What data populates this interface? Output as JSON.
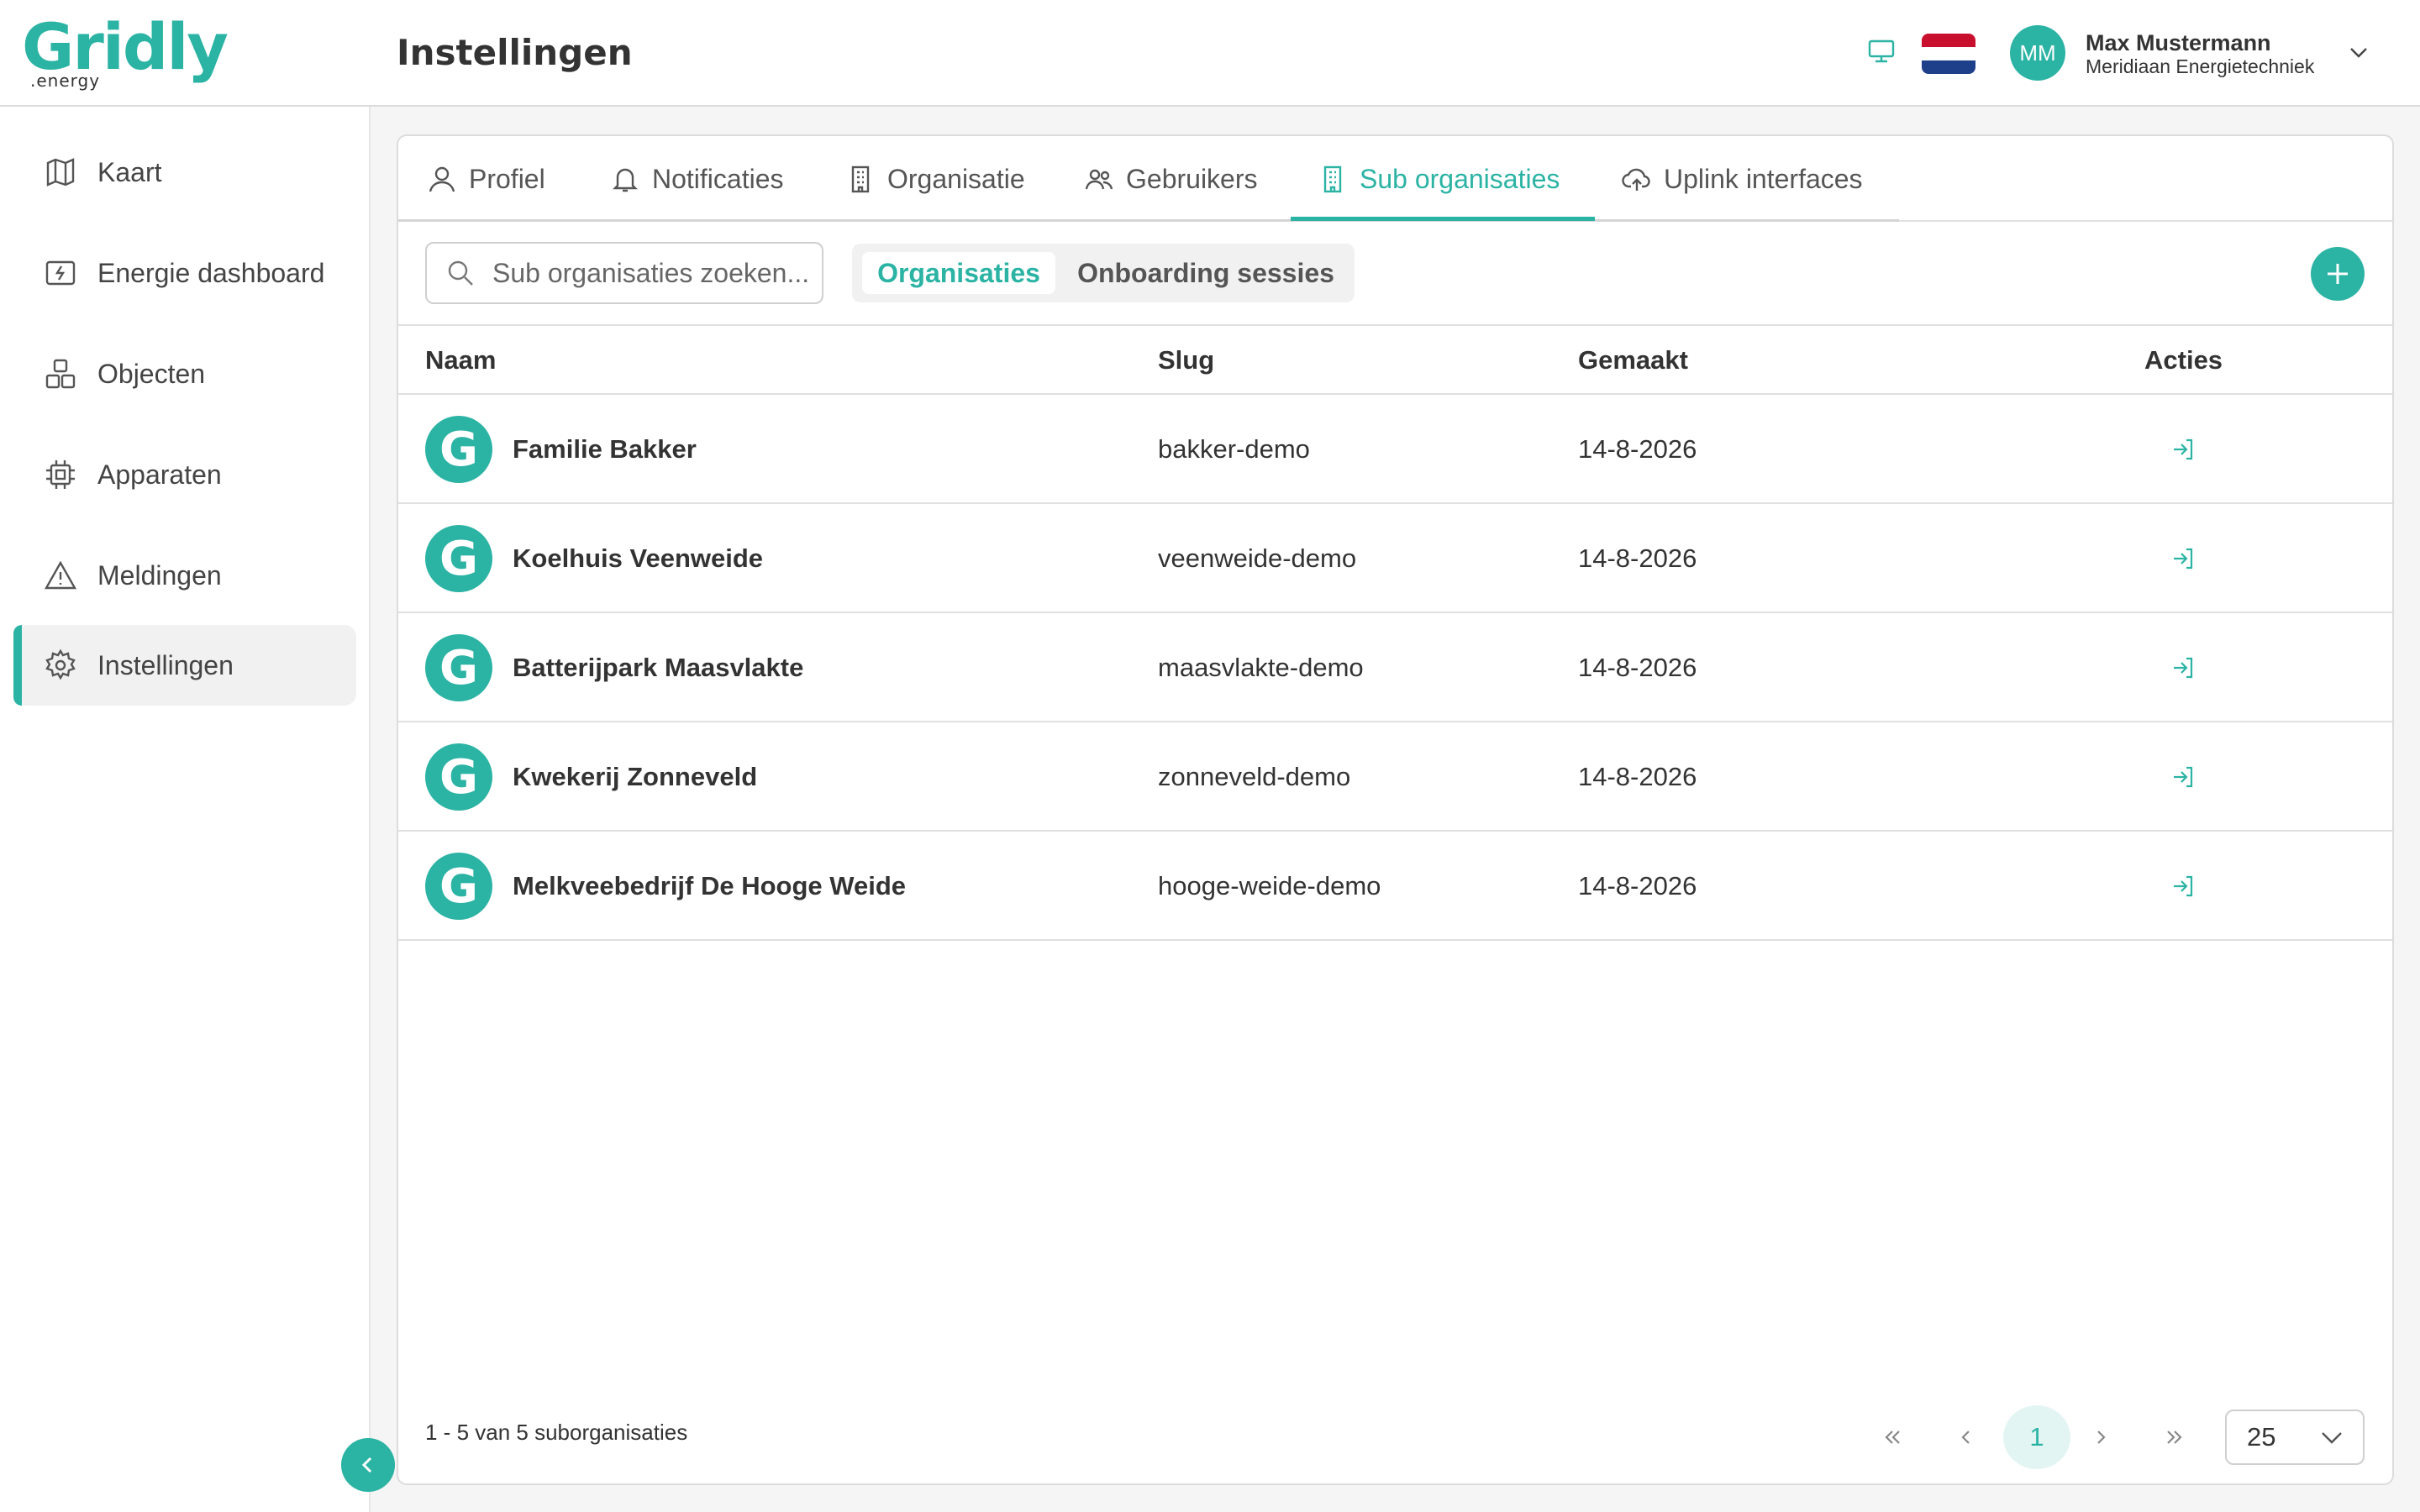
{
  "brand": {
    "name": "Gridly",
    "suffix": ".energy",
    "accent": "#2bb3a4"
  },
  "header": {
    "title": "Instellingen"
  },
  "user": {
    "initials": "MM",
    "name": "Max Mustermann",
    "organization": "Meridiaan Energietechniek"
  },
  "sidebar": {
    "items": [
      {
        "label": "Kaart",
        "icon": "map-icon"
      },
      {
        "label": "Energie dashboard",
        "icon": "dashboard-icon"
      },
      {
        "label": "Objecten",
        "icon": "objects-icon"
      },
      {
        "label": "Apparaten",
        "icon": "chip-icon"
      },
      {
        "label": "Meldingen",
        "icon": "warning-icon"
      },
      {
        "label": "Instellingen",
        "icon": "gear-icon",
        "active": true
      }
    ]
  },
  "tabs": [
    {
      "label": "Profiel",
      "icon": "user-icon"
    },
    {
      "label": "Notificaties",
      "icon": "bell-icon"
    },
    {
      "label": "Organisatie",
      "icon": "building-icon"
    },
    {
      "label": "Gebruikers",
      "icon": "users-icon"
    },
    {
      "label": "Sub organisaties",
      "icon": "building-icon",
      "active": true
    },
    {
      "label": "Uplink interfaces",
      "icon": "cloud-upload-icon"
    }
  ],
  "search": {
    "placeholder": "Sub organisaties zoeken..."
  },
  "segment": {
    "options": [
      "Organisaties",
      "Onboarding sessies"
    ],
    "selected": "Organisaties"
  },
  "table": {
    "columns": [
      "Naam",
      "Slug",
      "Gemaakt",
      "Acties"
    ],
    "rows": [
      {
        "logo": "G",
        "name": "Familie Bakker",
        "slug": "bakker-demo",
        "created": "14-8-2026"
      },
      {
        "logo": "G",
        "name": "Koelhuis Veenweide",
        "slug": "veenweide-demo",
        "created": "14-8-2026"
      },
      {
        "logo": "G",
        "name": "Batterijpark Maasvlakte",
        "slug": "maasvlakte-demo",
        "created": "14-8-2026"
      },
      {
        "logo": "G",
        "name": "Kwekerij Zonneveld",
        "slug": "zonneveld-demo",
        "created": "14-8-2026"
      },
      {
        "logo": "G",
        "name": "Melkveebedrijf De Hooge Weide",
        "slug": "hooge-weide-demo",
        "created": "14-8-2026"
      }
    ]
  },
  "footer": {
    "summary": "1 - 5 van 5 suborganisaties",
    "current_page": "1",
    "page_size": "25"
  }
}
